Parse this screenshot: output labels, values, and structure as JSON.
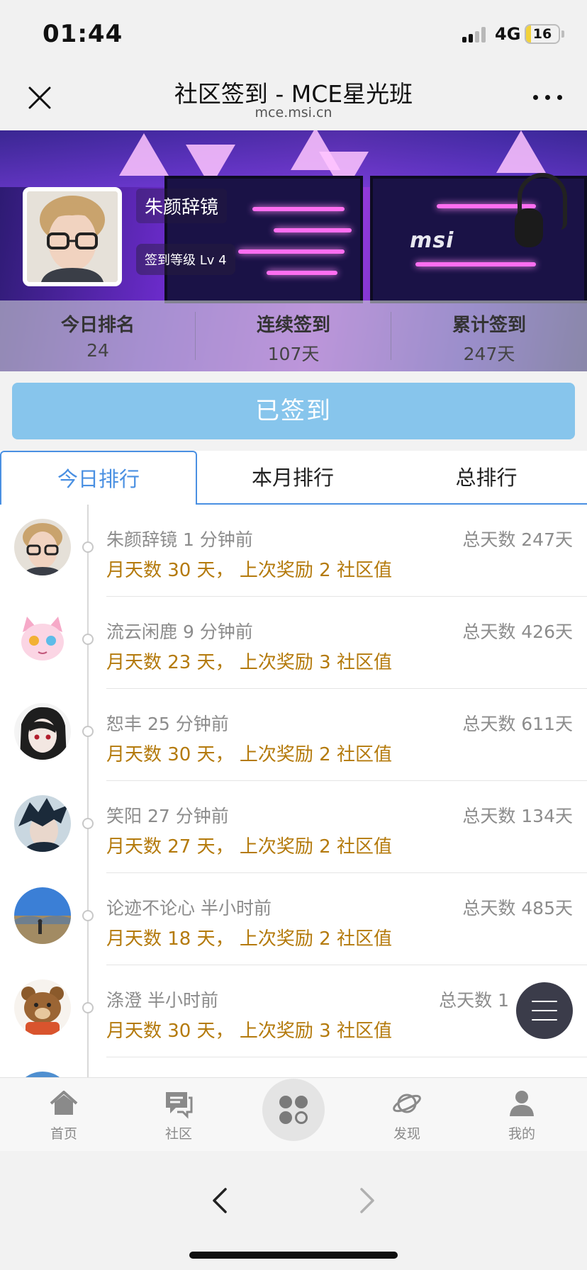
{
  "status_bar": {
    "time": "01:44",
    "network": "4G",
    "battery": "16",
    "battery_level": 0.16
  },
  "nav": {
    "title": "社区签到 - MCE星光班",
    "subtitle": "mce.msi.cn"
  },
  "banner": {
    "brand": "msi"
  },
  "profile": {
    "name": "朱颜辞镜",
    "level": "签到等级 Lv 4"
  },
  "stats": [
    {
      "label": "今日排名",
      "value": "24"
    },
    {
      "label": "连续签到",
      "value": "107天"
    },
    {
      "label": "累计签到",
      "value": "247天"
    }
  ],
  "checkin_button": "已签到",
  "tabs": [
    "今日排行",
    "本月排行",
    "总排行"
  ],
  "ranking": [
    {
      "name": "朱颜辞镜 1 分钟前",
      "total": "总天数 247天",
      "detail": "月天数 30 天， 上次奖励 2 社区值",
      "avatar": "portrait-glasses"
    },
    {
      "name": "流云闲鹿 9 分钟前",
      "total": "总天数 426天",
      "detail": "月天数 23 天， 上次奖励 3 社区值",
      "avatar": "anime-cat"
    },
    {
      "name": "恕丰 25 分钟前",
      "total": "总天数 611天",
      "detail": "月天数 30 天， 上次奖励 2 社区值",
      "avatar": "anime-girl"
    },
    {
      "name": "笑阳 27 分钟前",
      "total": "总天数 134天",
      "detail": "月天数 27 天， 上次奖励 2 社区值",
      "avatar": "anime-boy"
    },
    {
      "name": "论迹不论心 半小时前",
      "total": "总天数 485天",
      "detail": "月天数 18 天， 上次奖励 2 社区值",
      "avatar": "landscape"
    },
    {
      "name": "涤澄 半小时前",
      "total": "总天数 1",
      "detail": "月天数 30 天， 上次奖励 3 社区值",
      "avatar": "bear"
    }
  ],
  "tabbar": [
    "首页",
    "社区",
    "发现",
    "我的"
  ],
  "colors": {
    "accent": "#4a90e2",
    "checked": "#87c5ec",
    "reward": "#b47a0c"
  }
}
